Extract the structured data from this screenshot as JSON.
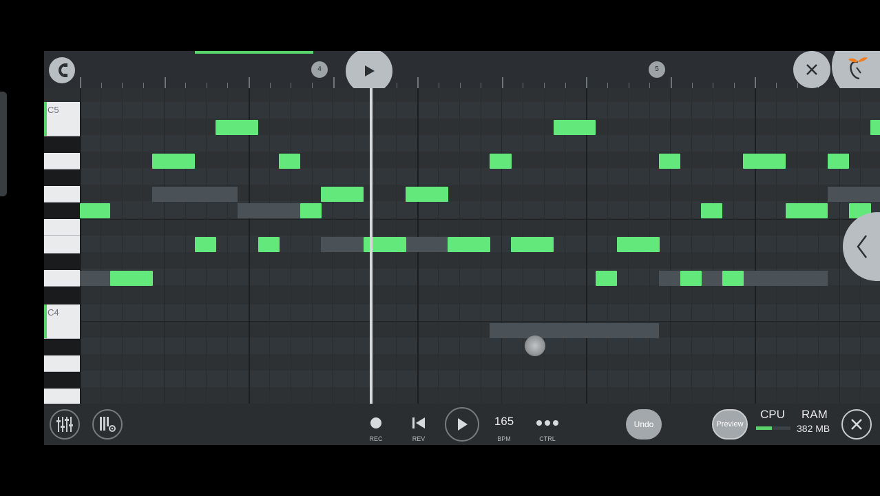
{
  "ruler": {
    "markers": [
      "4",
      "5"
    ]
  },
  "keyboard": {
    "labels": {
      "c5": "C5",
      "c4": "C4"
    }
  },
  "transport": {
    "rec_label": "REC",
    "rev_label": "REV",
    "bpm_value": "165",
    "bpm_label": "BPM",
    "ctrl_label": "CTRL"
  },
  "buttons": {
    "undo": "Undo",
    "preview": "Preview"
  },
  "stats": {
    "cpu_label": "CPU",
    "cpu_load": 0.45,
    "ram_label": "RAM",
    "ram_value": "382 MB"
  },
  "colors": {
    "note": "#62e87b",
    "accent": "#58d46b",
    "ghost": "#4a5257"
  },
  "icons": [
    "magnet-icon",
    "play-icon",
    "close-icon",
    "fl-fruit-icon",
    "chevron-left-icon",
    "mixer-icon",
    "piano-settings-icon",
    "record-icon",
    "rewind-icon",
    "close-icon"
  ]
}
